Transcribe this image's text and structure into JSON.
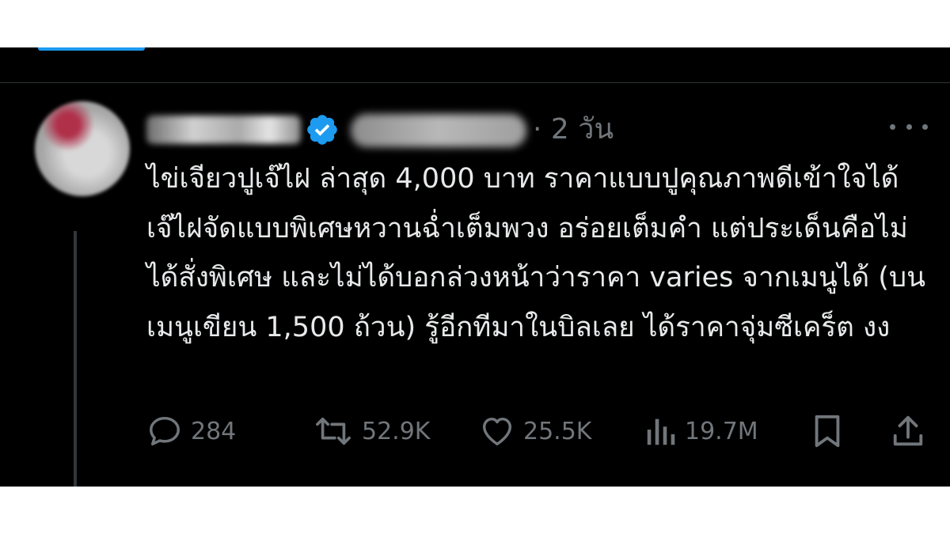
{
  "tweet": {
    "timestamp": "· 2 วัน",
    "text": "ไข่เจียวปูเจ๊ไฝ ล่าสุด 4,000 บาท ราคาแบบปูคุณภาพดีเข้าใจได้ เจ๊ไฝจัดแบบพิเศษหวานฉ่ำเต็มพวง อร่อยเต็มคำ แต่ประเด็นคือไม่ได้สั่งพิเศษ และไม่ได้บอกล่วงหน้าว่าราคา varies จากเมนูได้ (บนเมนูเขียน 1,500 ถ้วน) รู้อีกทีมาในบิลเลย ได้ราคาจุ่มซีเคร็ต งง"
  },
  "actions": {
    "replies": "284",
    "reposts": "52.9K",
    "likes": "25.5K",
    "views": "19.7M"
  },
  "icons": {
    "verified": "verified-badge-icon",
    "more": "more-icon",
    "reply": "reply-icon",
    "repost": "repost-icon",
    "like": "heart-icon",
    "views": "views-chart-icon",
    "bookmark": "bookmark-icon",
    "share": "share-icon"
  },
  "colors": {
    "background": "#000000",
    "text": "#e7e9ea",
    "muted": "#71767b",
    "accent": "#1d9bf0"
  }
}
